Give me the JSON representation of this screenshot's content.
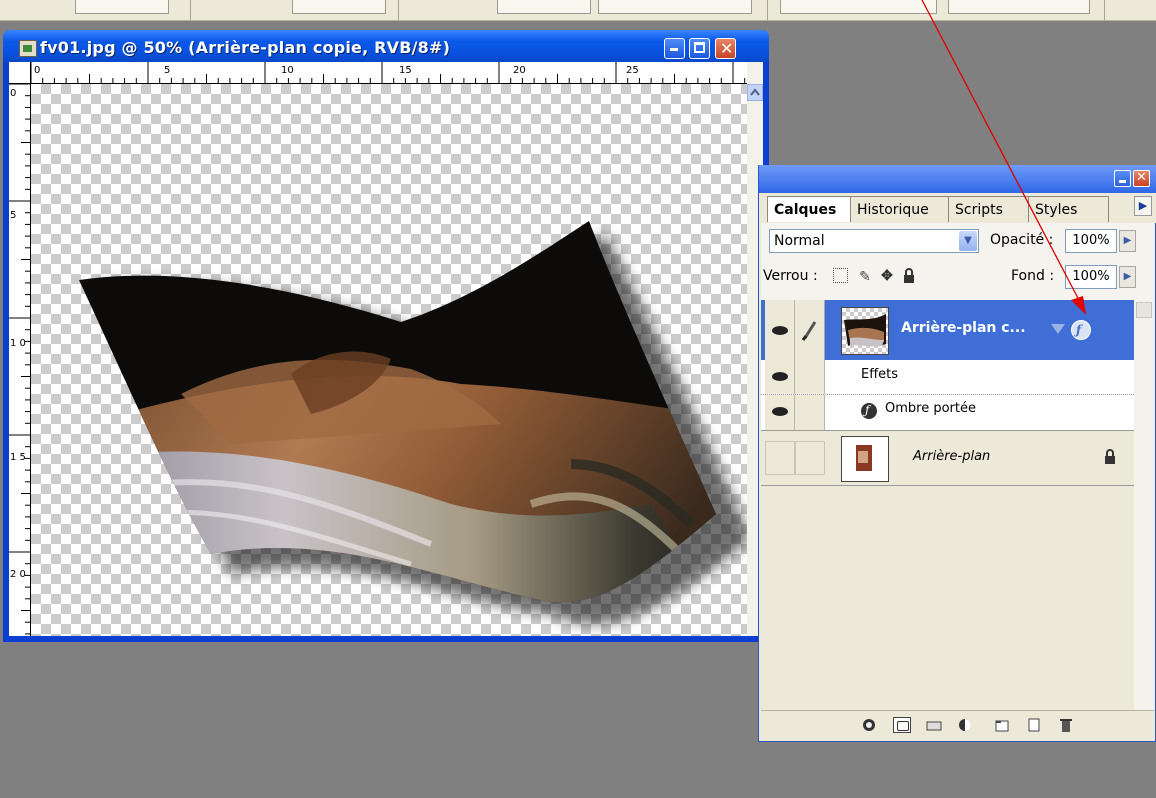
{
  "document_window": {
    "title": "fv01.jpg @ 50% (Arrière-plan copie, RVB/8#)",
    "ruler_h_labels": [
      "0",
      "5",
      "10",
      "15",
      "20",
      "25"
    ],
    "ruler_v_labels": [
      "0",
      "5",
      "1 0",
      "1 5",
      "2 0"
    ]
  },
  "layers_panel": {
    "tabs": [
      "Calques",
      "Historique",
      "Scripts",
      "Styles"
    ],
    "blend_mode": "Normal",
    "opacity_label": "Opacité :",
    "opacity_value": "100%",
    "lock_label": "Verrou :",
    "fill_label": "Fond :",
    "fill_value": "100%",
    "layers": [
      {
        "name": "Arrière-plan c...",
        "selected": true,
        "has_effects": true
      },
      {
        "name": "Effets",
        "type": "effects-header"
      },
      {
        "name": "Ombre portée",
        "type": "effect"
      },
      {
        "name": "Arrière-plan",
        "locked": true,
        "visible": false
      }
    ]
  },
  "colors": {
    "xp_title_blue": "#0b58e8",
    "selected_layer": "#3f6fd6",
    "annotation_arrow": "#e00000",
    "workspace_gray": "#808080"
  }
}
